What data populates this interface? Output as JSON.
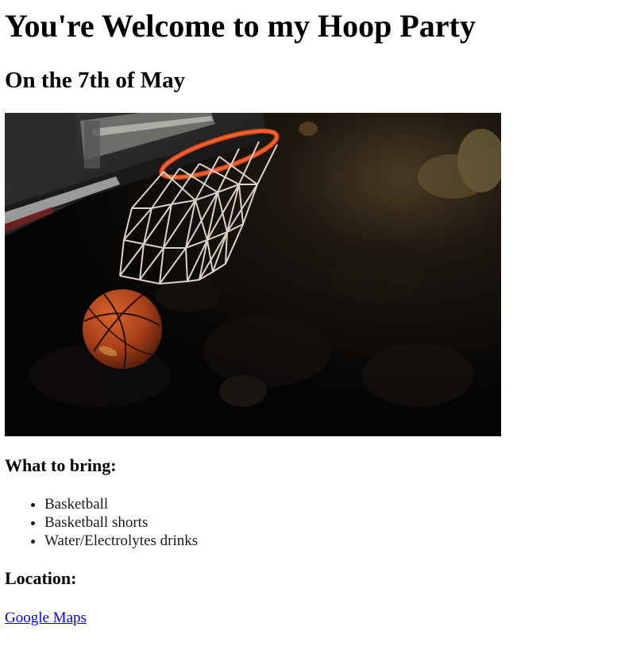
{
  "page": {
    "title": "You're Welcome to my Hoop Party",
    "subtitle": "On the 7th of May"
  },
  "photo": {
    "description_icon": "basketball-hoop-photo"
  },
  "bring": {
    "heading": "What to bring:",
    "items": [
      "Basketball",
      "Basketball shorts",
      "Water/Electrolytes drinks"
    ]
  },
  "location": {
    "heading": "Location:",
    "link_label": "Google Maps"
  },
  "colors": {
    "link": "#0000ee",
    "rim": "#e2481d",
    "ball": "#b4441c"
  }
}
